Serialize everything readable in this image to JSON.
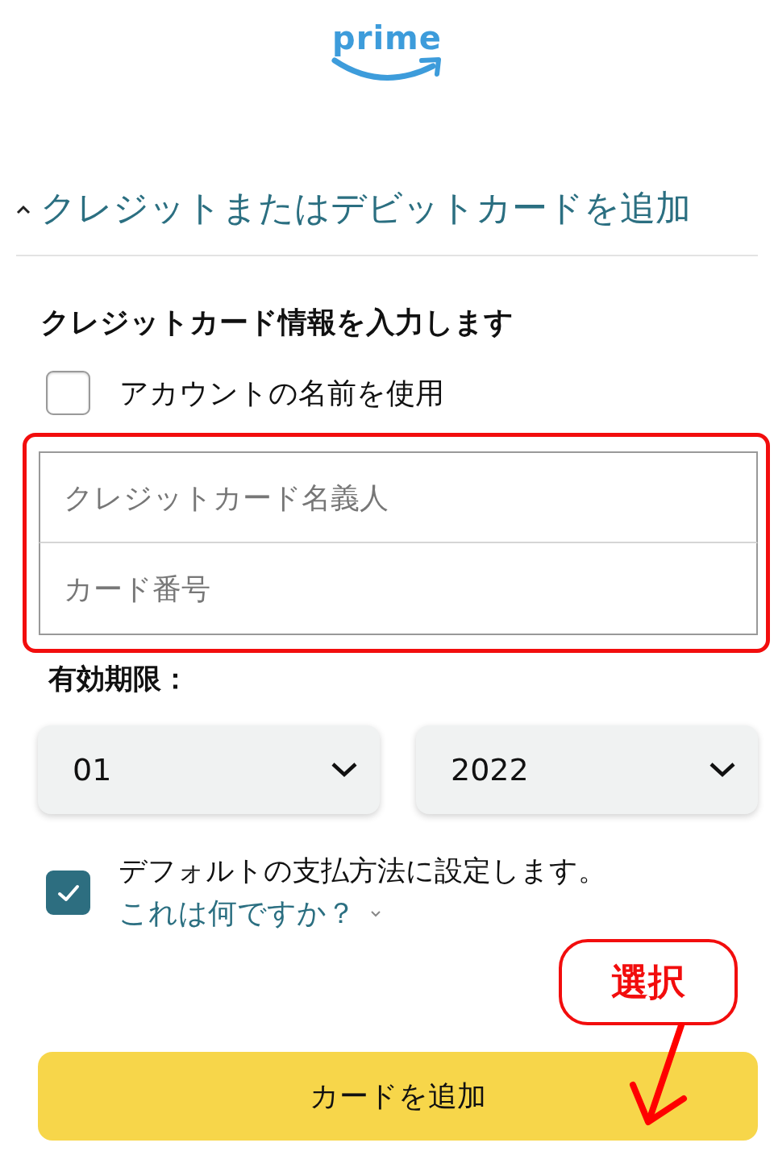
{
  "logo": {
    "text": "prime"
  },
  "section": {
    "title": "クレジットまたはデビットカードを追加",
    "expanded": true
  },
  "form": {
    "heading": "クレジットカード情報を入力します",
    "use_account_name": {
      "label": "アカウントの名前を使用",
      "checked": false
    },
    "fields_highlighted": true,
    "fields": [
      {
        "placeholder": "クレジットカード名義人"
      },
      {
        "placeholder": "カード番号"
      }
    ],
    "expiry": {
      "label": "有効期限：",
      "selects": [
        {
          "value": "01"
        },
        {
          "value": "2022"
        }
      ]
    },
    "default_payment": {
      "label": "デフォルトの支払方法に設定します。",
      "checked": true,
      "help_link": "これは何ですか？"
    }
  },
  "annotation": {
    "callout": "選択"
  },
  "submit_button": {
    "label": "カードを追加"
  }
}
